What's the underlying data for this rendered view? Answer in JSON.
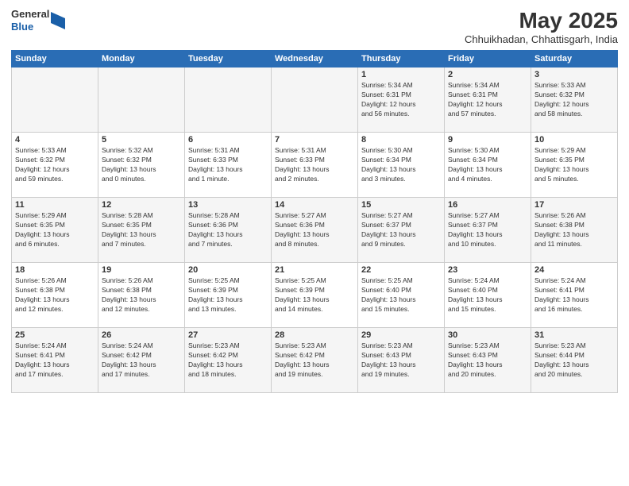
{
  "header": {
    "logo_general": "General",
    "logo_blue": "Blue",
    "month_title": "May 2025",
    "location": "Chhuikhadan, Chhattisgarh, India"
  },
  "days_of_week": [
    "Sunday",
    "Monday",
    "Tuesday",
    "Wednesday",
    "Thursday",
    "Friday",
    "Saturday"
  ],
  "rows": [
    {
      "cells": [
        {
          "day": "",
          "info": ""
        },
        {
          "day": "",
          "info": ""
        },
        {
          "day": "",
          "info": ""
        },
        {
          "day": "",
          "info": ""
        },
        {
          "day": "1",
          "info": "Sunrise: 5:34 AM\nSunset: 6:31 PM\nDaylight: 12 hours\nand 56 minutes."
        },
        {
          "day": "2",
          "info": "Sunrise: 5:34 AM\nSunset: 6:31 PM\nDaylight: 12 hours\nand 57 minutes."
        },
        {
          "day": "3",
          "info": "Sunrise: 5:33 AM\nSunset: 6:32 PM\nDaylight: 12 hours\nand 58 minutes."
        }
      ]
    },
    {
      "cells": [
        {
          "day": "4",
          "info": "Sunrise: 5:33 AM\nSunset: 6:32 PM\nDaylight: 12 hours\nand 59 minutes."
        },
        {
          "day": "5",
          "info": "Sunrise: 5:32 AM\nSunset: 6:32 PM\nDaylight: 13 hours\nand 0 minutes."
        },
        {
          "day": "6",
          "info": "Sunrise: 5:31 AM\nSunset: 6:33 PM\nDaylight: 13 hours\nand 1 minute."
        },
        {
          "day": "7",
          "info": "Sunrise: 5:31 AM\nSunset: 6:33 PM\nDaylight: 13 hours\nand 2 minutes."
        },
        {
          "day": "8",
          "info": "Sunrise: 5:30 AM\nSunset: 6:34 PM\nDaylight: 13 hours\nand 3 minutes."
        },
        {
          "day": "9",
          "info": "Sunrise: 5:30 AM\nSunset: 6:34 PM\nDaylight: 13 hours\nand 4 minutes."
        },
        {
          "day": "10",
          "info": "Sunrise: 5:29 AM\nSunset: 6:35 PM\nDaylight: 13 hours\nand 5 minutes."
        }
      ]
    },
    {
      "cells": [
        {
          "day": "11",
          "info": "Sunrise: 5:29 AM\nSunset: 6:35 PM\nDaylight: 13 hours\nand 6 minutes."
        },
        {
          "day": "12",
          "info": "Sunrise: 5:28 AM\nSunset: 6:35 PM\nDaylight: 13 hours\nand 7 minutes."
        },
        {
          "day": "13",
          "info": "Sunrise: 5:28 AM\nSunset: 6:36 PM\nDaylight: 13 hours\nand 7 minutes."
        },
        {
          "day": "14",
          "info": "Sunrise: 5:27 AM\nSunset: 6:36 PM\nDaylight: 13 hours\nand 8 minutes."
        },
        {
          "day": "15",
          "info": "Sunrise: 5:27 AM\nSunset: 6:37 PM\nDaylight: 13 hours\nand 9 minutes."
        },
        {
          "day": "16",
          "info": "Sunrise: 5:27 AM\nSunset: 6:37 PM\nDaylight: 13 hours\nand 10 minutes."
        },
        {
          "day": "17",
          "info": "Sunrise: 5:26 AM\nSunset: 6:38 PM\nDaylight: 13 hours\nand 11 minutes."
        }
      ]
    },
    {
      "cells": [
        {
          "day": "18",
          "info": "Sunrise: 5:26 AM\nSunset: 6:38 PM\nDaylight: 13 hours\nand 12 minutes."
        },
        {
          "day": "19",
          "info": "Sunrise: 5:26 AM\nSunset: 6:38 PM\nDaylight: 13 hours\nand 12 minutes."
        },
        {
          "day": "20",
          "info": "Sunrise: 5:25 AM\nSunset: 6:39 PM\nDaylight: 13 hours\nand 13 minutes."
        },
        {
          "day": "21",
          "info": "Sunrise: 5:25 AM\nSunset: 6:39 PM\nDaylight: 13 hours\nand 14 minutes."
        },
        {
          "day": "22",
          "info": "Sunrise: 5:25 AM\nSunset: 6:40 PM\nDaylight: 13 hours\nand 15 minutes."
        },
        {
          "day": "23",
          "info": "Sunrise: 5:24 AM\nSunset: 6:40 PM\nDaylight: 13 hours\nand 15 minutes."
        },
        {
          "day": "24",
          "info": "Sunrise: 5:24 AM\nSunset: 6:41 PM\nDaylight: 13 hours\nand 16 minutes."
        }
      ]
    },
    {
      "cells": [
        {
          "day": "25",
          "info": "Sunrise: 5:24 AM\nSunset: 6:41 PM\nDaylight: 13 hours\nand 17 minutes."
        },
        {
          "day": "26",
          "info": "Sunrise: 5:24 AM\nSunset: 6:42 PM\nDaylight: 13 hours\nand 17 minutes."
        },
        {
          "day": "27",
          "info": "Sunrise: 5:23 AM\nSunset: 6:42 PM\nDaylight: 13 hours\nand 18 minutes."
        },
        {
          "day": "28",
          "info": "Sunrise: 5:23 AM\nSunset: 6:42 PM\nDaylight: 13 hours\nand 19 minutes."
        },
        {
          "day": "29",
          "info": "Sunrise: 5:23 AM\nSunset: 6:43 PM\nDaylight: 13 hours\nand 19 minutes."
        },
        {
          "day": "30",
          "info": "Sunrise: 5:23 AM\nSunset: 6:43 PM\nDaylight: 13 hours\nand 20 minutes."
        },
        {
          "day": "31",
          "info": "Sunrise: 5:23 AM\nSunset: 6:44 PM\nDaylight: 13 hours\nand 20 minutes."
        }
      ]
    }
  ]
}
